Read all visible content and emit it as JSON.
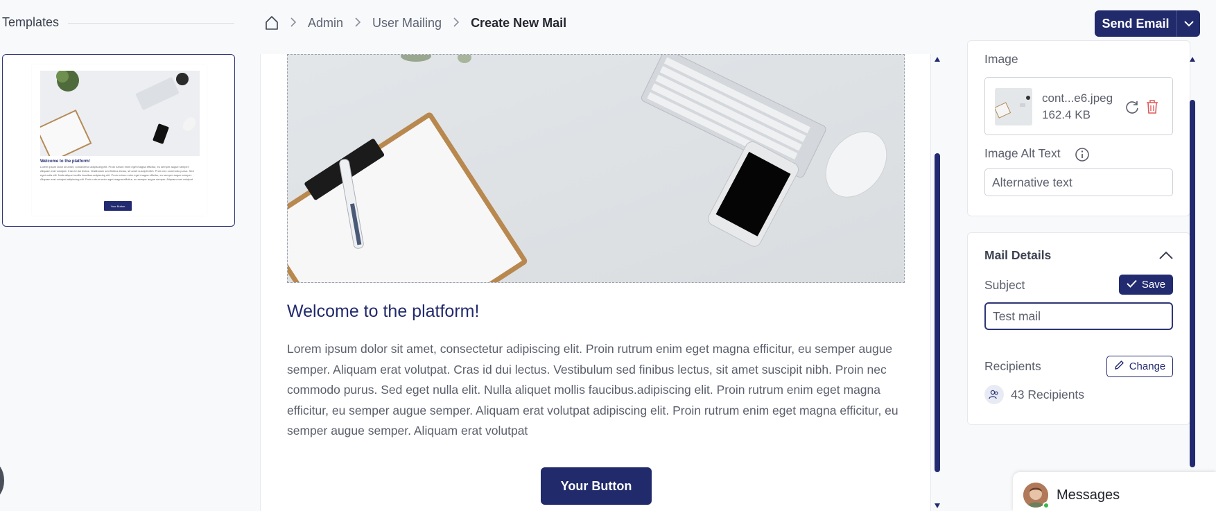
{
  "header": {
    "templates_title": "Templates",
    "breadcrumb": [
      "Admin",
      "User Mailing"
    ],
    "breadcrumb_current": "Create New Mail",
    "send_label": "Send Email"
  },
  "template_thumb": {
    "title": "Welcome to the platform!",
    "text": "Lorem ipsum dolor sit amet, consectetur adipiscing elit. Proin rutrum enim eget magna efficitur, eu semper augue semper. Aliquam erat volutpat. Cras id dui lectus. Vestibulum sed finibus lectus, sit amet suscipit nibh. Proin nec commodo purus. Sed eget nulla elit. Nulla aliquet mollis faucibus.adipiscing elit. Proin rutrum enim eget magna efficitur, eu semper augue semper. Aliquam erat volutpat adipiscing elit. Proin rutrum enim eget magna efficitur, eu semper augue semper. Aliquam erat volutpat",
    "button": "Your Button"
  },
  "mail": {
    "title": "Welcome to the platform!",
    "body": "Lorem ipsum dolor sit amet, consectetur adipiscing elit. Proin rutrum enim eget magna efficitur, eu semper augue semper. Aliquam erat volutpat. Cras id dui lectus. Vestibulum sed finibus lectus, sit amet suscipit nibh. Proin nec commodo purus. Sed eget nulla elit. Nulla aliquet mollis faucibus.adipiscing elit. Proin rutrum enim eget magna efficitur, eu semper augue semper. Aliquam erat volutpat adipiscing elit. Proin rutrum enim eget magna efficitur, eu semper augue semper. Aliquam erat volutpat",
    "button": "Your Button"
  },
  "image_settings": {
    "label": "Image",
    "file_name": "cont...e6.jpeg",
    "file_size": "162.4 KB",
    "alt_label": "Image Alt Text",
    "alt_placeholder": "Alternative text"
  },
  "mail_details": {
    "title": "Mail Details",
    "subject_label": "Subject",
    "save_label": "Save",
    "subject_value": "Test mail",
    "recipients_label": "Recipients",
    "change_label": "Change",
    "recipients_count": "43 Recipients"
  },
  "messages": {
    "label": "Messages"
  },
  "colors": {
    "primary": "#212a6b",
    "delete": "#e25858",
    "status_online": "#3bb54a"
  },
  "icons": [
    "home-icon",
    "chevron-right-icon",
    "chevron-down-icon",
    "refresh-icon",
    "trash-icon",
    "info-icon",
    "chevron-up-icon",
    "check-icon",
    "pencil-icon",
    "users-icon"
  ]
}
